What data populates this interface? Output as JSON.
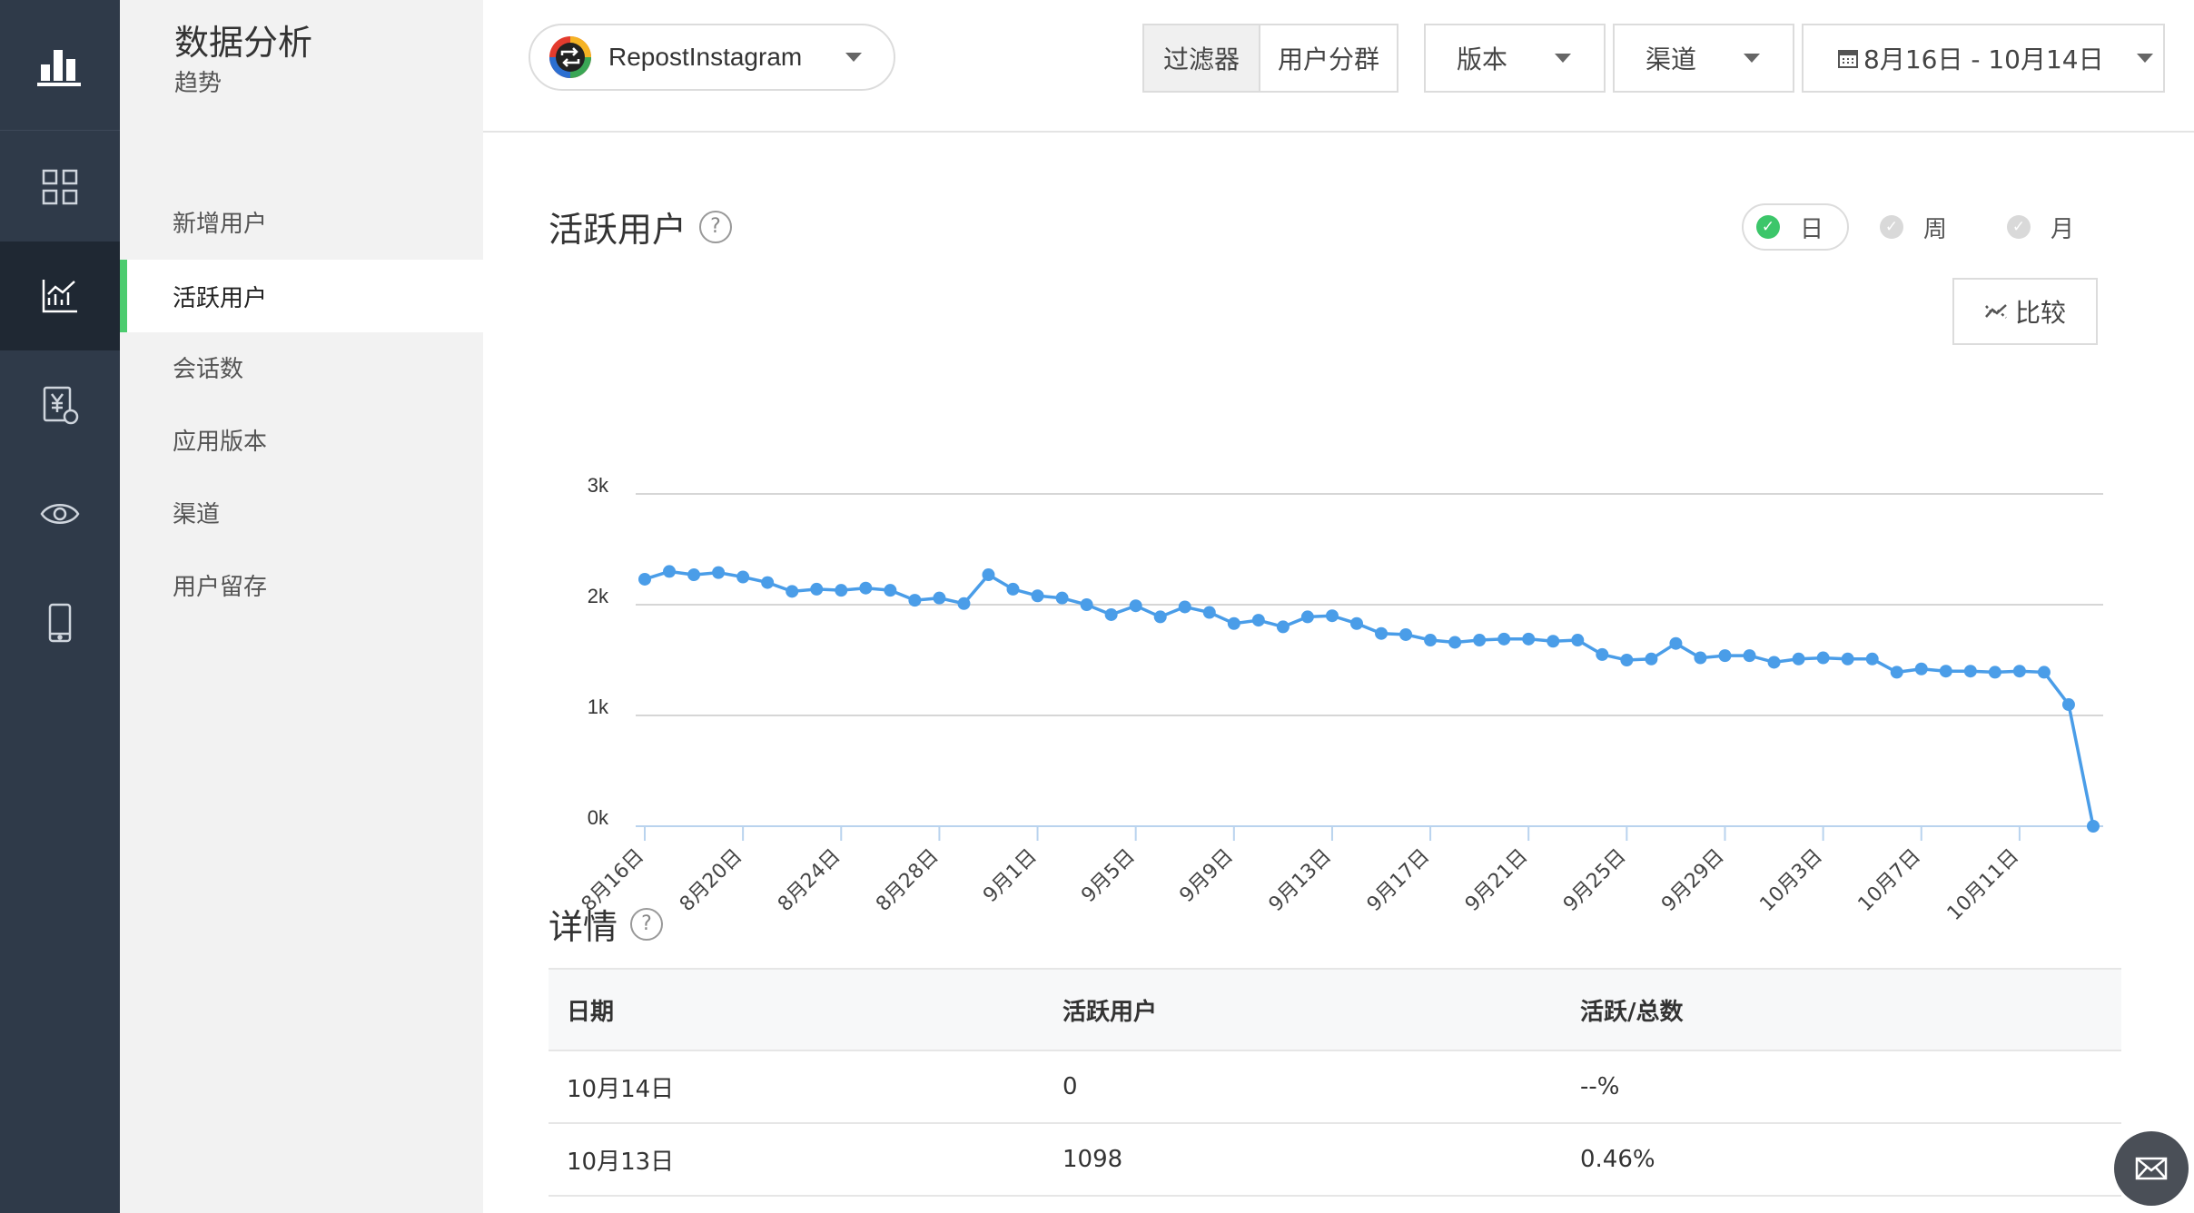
{
  "sidebar_rail": {
    "items": [
      {
        "name": "overview-icon"
      },
      {
        "name": "trend-chart-icon",
        "active": true
      },
      {
        "name": "revenue-icon"
      },
      {
        "name": "eye-icon"
      },
      {
        "name": "mobile-device-icon"
      }
    ]
  },
  "subnav": {
    "title": "数据分析",
    "subtitle": "趋势",
    "items": [
      {
        "label": "新增用户"
      },
      {
        "label": "活跃用户",
        "active": true
      },
      {
        "label": "会话数"
      },
      {
        "label": "应用版本"
      },
      {
        "label": "渠道"
      },
      {
        "label": "用户留存"
      }
    ]
  },
  "topbar": {
    "app_name": "RepostInstagram",
    "filter_label": "过滤器",
    "segment_label": "用户分群",
    "version_label": "版本",
    "channel_label": "渠道",
    "date_range": "8月16日 - 10月14日"
  },
  "chart_section": {
    "title": "活跃用户",
    "help": "?",
    "periods": [
      {
        "label": "日",
        "selected": true
      },
      {
        "label": "周",
        "selected": false
      },
      {
        "label": "月",
        "selected": false
      }
    ],
    "compare_label": "比较"
  },
  "chart_data": {
    "type": "line",
    "y_ticks": [
      "3k",
      "2k",
      "1k",
      "0k"
    ],
    "ylim": [
      0,
      3000
    ],
    "x_tick_labels": [
      "8月16日",
      "8月20日",
      "8月24日",
      "8月28日",
      "9月1日",
      "9月5日",
      "9月9日",
      "9月13日",
      "9月17日",
      "9月21日",
      "9月25日",
      "9月29日",
      "10月3日",
      "10月7日",
      "10月11日"
    ],
    "grid": true,
    "color": "#4a9de8",
    "series": [
      {
        "x_start": "8月16日",
        "values": [
          2230,
          2300,
          2270,
          2290,
          2250,
          2200,
          2120,
          2140,
          2130,
          2150,
          2130,
          2040,
          2060,
          2010,
          2270,
          2140,
          2080,
          2060,
          2000,
          1910,
          1990,
          1890,
          1980,
          1930,
          1830,
          1860,
          1800,
          1890,
          1900,
          1830,
          1740,
          1730,
          1680,
          1660,
          1680,
          1690,
          1690,
          1670,
          1680,
          1550,
          1500,
          1510,
          1650,
          1520,
          1540,
          1540,
          1480,
          1510,
          1520,
          1510,
          1510,
          1390,
          1420,
          1400,
          1400,
          1390,
          1400,
          1390,
          1098,
          0
        ]
      }
    ]
  },
  "detail_section": {
    "title": "详情",
    "help": "?",
    "columns": [
      "日期",
      "活跃用户",
      "活跃/总数"
    ],
    "rows": [
      [
        "10月14日",
        "0",
        "--%"
      ],
      [
        "10月13日",
        "1098",
        "0.46%"
      ]
    ]
  },
  "colors": {
    "rail_bg": "#2f3a49",
    "accent_green": "#4ccc6f",
    "line_blue": "#4a9de8"
  }
}
